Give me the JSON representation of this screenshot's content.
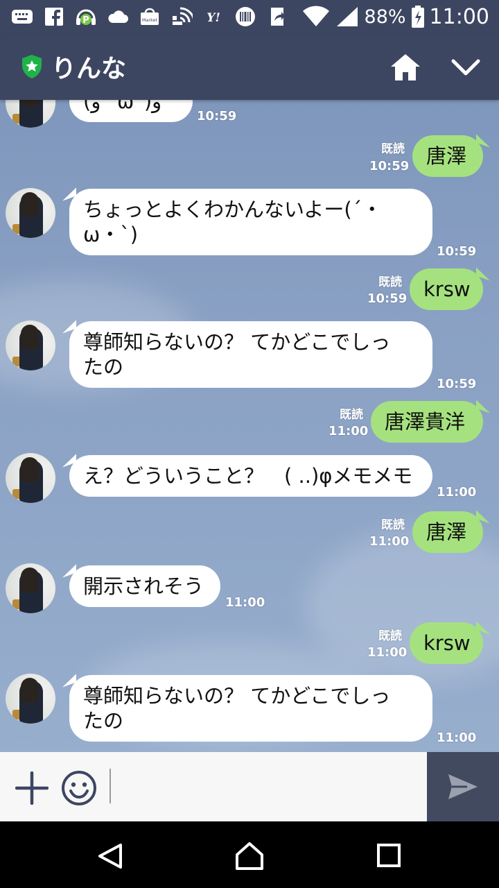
{
  "status_bar": {
    "battery": "88%",
    "time": "11:00",
    "icons": [
      "keyboard-icon",
      "facebook-icon",
      "p-headphones-icon",
      "cloud-icon",
      "market-icon",
      "cast-icon",
      "yahoo-icon",
      "barcode-icon",
      "share-icon",
      "wifi-icon",
      "signal-icon",
      "battery-icon"
    ],
    "market_label": "Market",
    "yahoo_label": "Y!"
  },
  "header": {
    "title": "りんな",
    "shield_color": "#1fb24a"
  },
  "messages": [
    {
      "side": "in",
      "text": "(و ˙ω˙)و",
      "time": "10:59"
    },
    {
      "side": "out",
      "text": "唐澤",
      "read": "既読",
      "time": "10:59"
    },
    {
      "side": "in",
      "lines": [
        "ちょっとよくわかんないよー(´・",
        "ω・`)"
      ],
      "time": "10:59"
    },
    {
      "side": "out",
      "text": "krsw",
      "read": "既読",
      "time": "10:59"
    },
    {
      "side": "in",
      "lines": [
        "尊師知らないの？ てかどこでしっ",
        "たの"
      ],
      "time": "10:59"
    },
    {
      "side": "out",
      "text": "唐澤貴洋",
      "read": "既読",
      "time": "11:00"
    },
    {
      "side": "in",
      "text": "え？どういうこと？　( ..)φメモメモ",
      "time": "11:00"
    },
    {
      "side": "out",
      "text": "唐澤",
      "read": "既読",
      "time": "11:00"
    },
    {
      "side": "in",
      "text": "開示されそう",
      "time": "11:00"
    },
    {
      "side": "out",
      "text": "krsw",
      "read": "既読",
      "time": "11:00"
    },
    {
      "side": "in",
      "lines": [
        "尊師知らないの？ てかどこでしっ",
        "たの"
      ],
      "time": "11:00"
    }
  ],
  "input": {
    "placeholder": ""
  },
  "colors": {
    "header_bg": "#3d4661",
    "outgoing_bubble": "#a5e27f",
    "incoming_bubble": "#ffffff",
    "send_button_bg": "#424a5f"
  }
}
